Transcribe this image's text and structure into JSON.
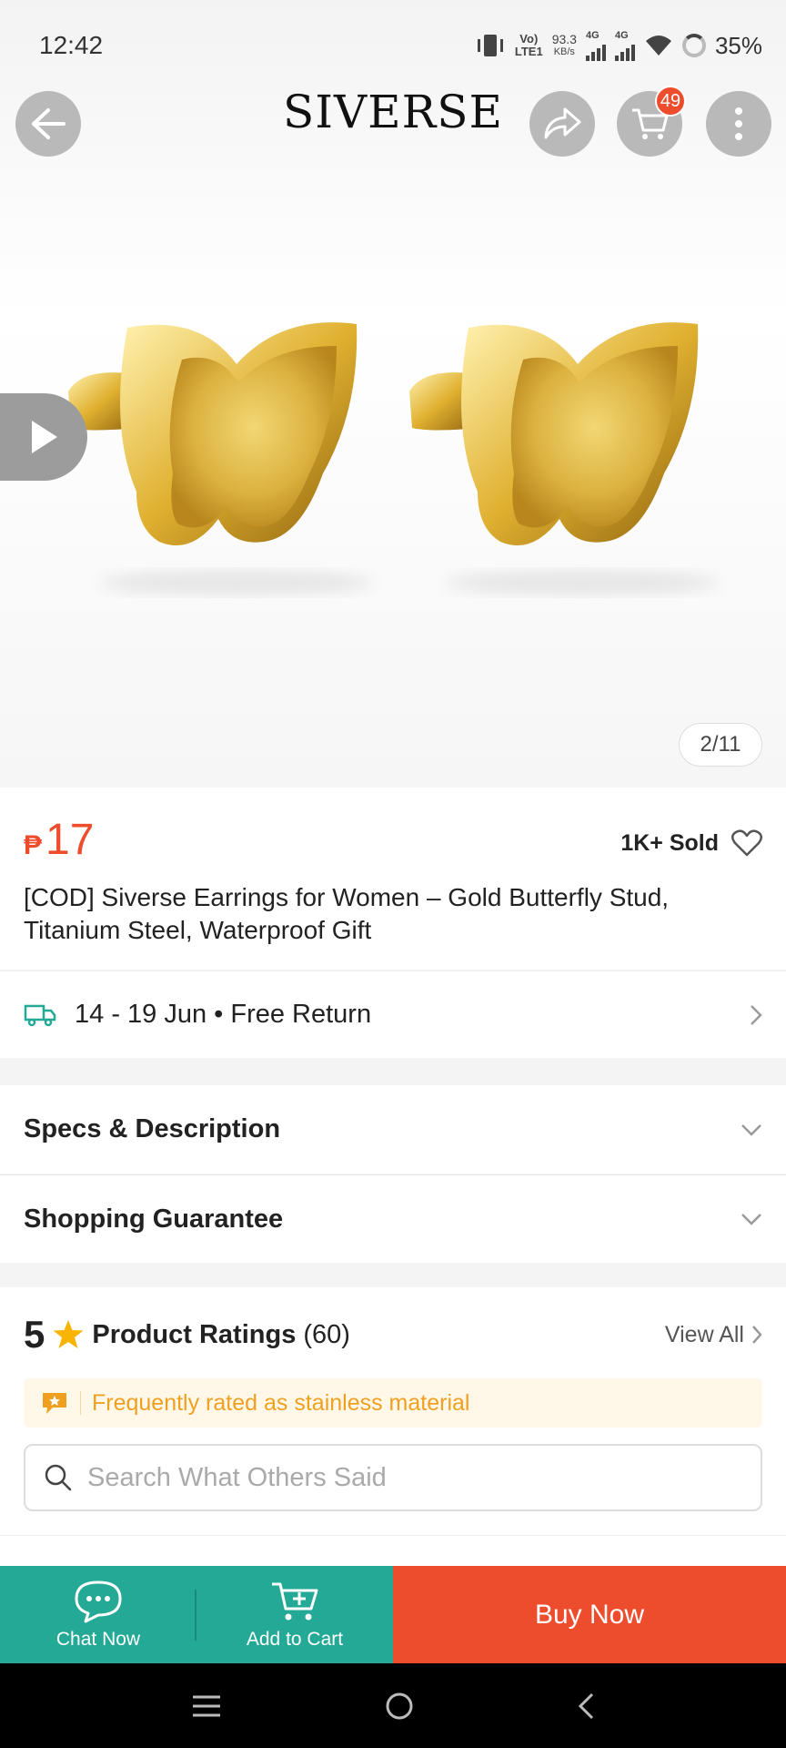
{
  "status_bar": {
    "time": "12:42",
    "volte": "Vo)",
    "lte": "LTE1",
    "speed_value": "93.3",
    "speed_unit": "KB/s",
    "net1": "4G",
    "net2": "4G",
    "battery": "35%"
  },
  "header": {
    "brand": "SIVERSE",
    "cart_count": "49"
  },
  "gallery": {
    "counter": "2/11",
    "image_subject": "gold butterfly stud earrings"
  },
  "product": {
    "currency": "₱",
    "price": "17",
    "sold": "1K+ Sold",
    "title": "[COD] Siverse Earrings for Women – Gold Butterfly Stud, Titanium Steel, Waterproof Gift"
  },
  "delivery": {
    "text": "14 - 19 Jun • Free Return"
  },
  "sections": {
    "specs": "Specs & Description",
    "guarantee": "Shopping Guarantee"
  },
  "ratings": {
    "score": "5",
    "label": "Product Ratings",
    "count": "(60)",
    "view_all": "View All",
    "tag": "Frequently rated as stainless material",
    "search_placeholder": "Search What Others Said"
  },
  "actions": {
    "chat": "Chat Now",
    "add_to_cart": "Add to Cart",
    "buy_now": "Buy Now"
  },
  "colors": {
    "accent": "#ee4d2d",
    "teal": "#23a995",
    "gold": "#d4a52a"
  }
}
